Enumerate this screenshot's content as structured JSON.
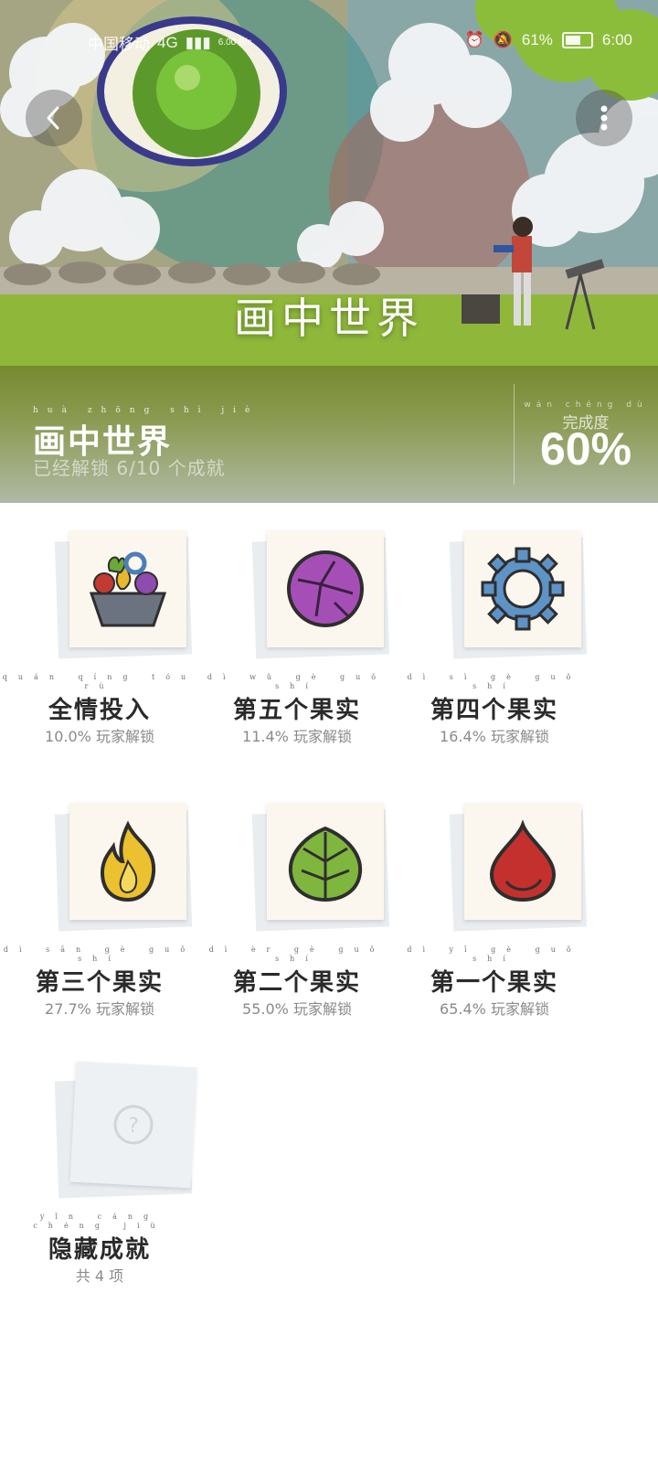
{
  "status_bar": {
    "carrier": "中国移动",
    "network": "4G",
    "speed": "6.00 B/s",
    "battery": "61%",
    "time": "6:00"
  },
  "hero": {
    "title": "画中世界",
    "back_icon": "chevron-left-icon",
    "more_icon": "more-vertical-icon"
  },
  "info": {
    "name_pinyin": "huà zhōng shì jiè",
    "name": "画中世界",
    "subtitle": "已经解锁 6/10 个成就",
    "completion_pinyin": "wán chéng dù",
    "completion_label": "完成度",
    "completion_value": "60%",
    "accent_color": "#7e902f"
  },
  "achievements": [
    {
      "pinyin": "quán qíng tóu rù",
      "title": "全情投入",
      "stat": "10.0% 玩家解锁",
      "icon": "fruit-basket-icon"
    },
    {
      "pinyin": "dì wǔ gè guǒ shí",
      "title": "第五个果实",
      "stat": "11.4% 玩家解锁",
      "icon": "purple-fruit-icon"
    },
    {
      "pinyin": "dì sì gè guǒ shí",
      "title": "第四个果实",
      "stat": "16.4% 玩家解锁",
      "icon": "gear-icon"
    },
    {
      "pinyin": "dì sān gè guǒ shí",
      "title": "第三个果实",
      "stat": "27.7% 玩家解锁",
      "icon": "flame-icon"
    },
    {
      "pinyin": "dì èr gè guǒ shí",
      "title": "第二个果实",
      "stat": "55.0% 玩家解锁",
      "icon": "green-leaf-fruit-icon"
    },
    {
      "pinyin": "dì yī gè guǒ shí",
      "title": "第一个果实",
      "stat": "65.4% 玩家解锁",
      "icon": "red-fruit-icon"
    }
  ],
  "hidden": {
    "pinyin": "yǐn cáng chéng jiù",
    "title": "隐藏成就",
    "stat": "共 4 项",
    "icon": "question-mark-icon"
  }
}
